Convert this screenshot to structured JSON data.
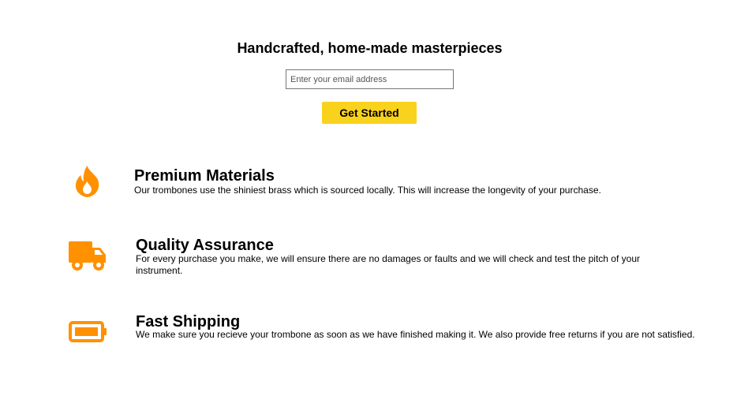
{
  "hero": {
    "title": "Handcrafted, home-made masterpieces",
    "email_placeholder": "Enter your email address",
    "cta_label": "Get Started"
  },
  "accent_color": "#ff9100",
  "button_color": "#f9d21d",
  "features": [
    {
      "icon": "fire-icon",
      "title": "Premium Materials",
      "description": "Our trombones use the shiniest brass which is sourced locally. This will increase the longevity of your purchase."
    },
    {
      "icon": "truck-icon",
      "title": "Quality Assurance",
      "description": "For every purchase you make, we will ensure there are no damages or faults and we will check and test the pitch of your instrument."
    },
    {
      "icon": "battery-icon",
      "title": "Fast Shipping",
      "description": "We make sure you recieve your trombone as soon as we have finished making it. We also provide free returns if you are not satisfied."
    }
  ]
}
